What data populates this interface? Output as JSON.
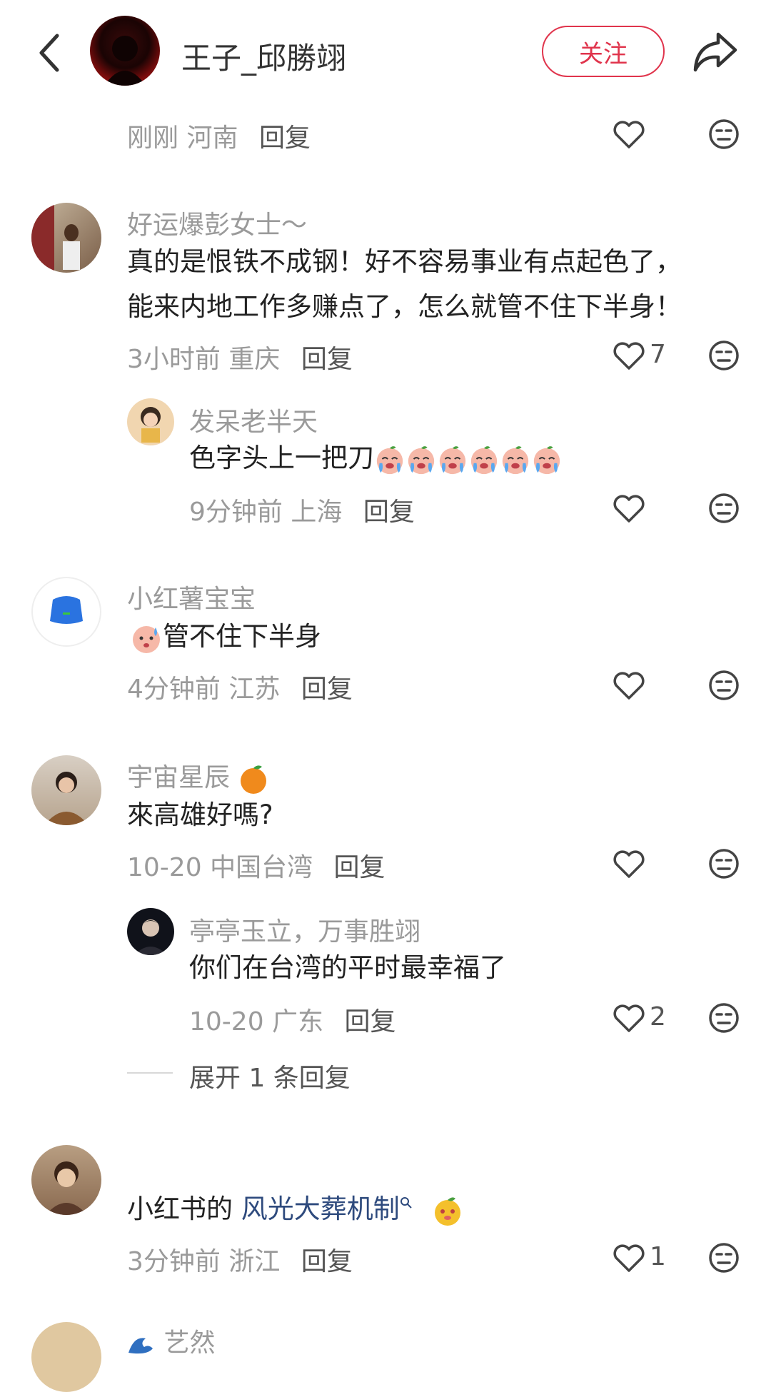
{
  "header": {
    "user_name": "王子_邱勝翊",
    "follow_label": "关注"
  },
  "top_comment": {
    "time": "刚刚",
    "location": "河南",
    "reply_label": "回复"
  },
  "comments": [
    {
      "user": "好运爆彭女士～",
      "lines": [
        "真的是恨铁不成钢！好不容易事业有点起色了，",
        "能来内地工作多赚点了，怎么就管不住下半身！"
      ],
      "time": "3小时前",
      "location": "重庆",
      "reply_label": "回复",
      "likes": "7"
    },
    {
      "user": "发呆老半天",
      "text": "色字头上一把刀",
      "time": "9分钟前",
      "location": "上海",
      "reply_label": "回复",
      "likes": ""
    },
    {
      "user": "小红薯宝宝",
      "text": "管不住下半身",
      "time": "4分钟前",
      "location": "江苏",
      "reply_label": "回复",
      "likes": ""
    },
    {
      "user": "宇宙星辰",
      "text": "來高雄好嗎?",
      "time": "10-20",
      "location": "中国台湾",
      "reply_label": "回复",
      "likes": ""
    },
    {
      "user": "亭亭玉立，万事胜翊",
      "text": "你们在台湾的平时最幸福了",
      "time": "10-20",
      "location": "广东",
      "reply_label": "回复",
      "likes": "2"
    },
    {
      "user": "",
      "text_prefix": "小红书的 ",
      "link": "风光大葬机制",
      "time": "3分钟前",
      "location": "浙江",
      "reply_label": "回复",
      "likes": "1"
    },
    {
      "user": "艺然"
    }
  ],
  "expand_replies_label": "展开 1 条回复",
  "colors": {
    "accent": "#e0344c",
    "muted": "#9a9a9a",
    "link": "#2e4a7d"
  },
  "icons": [
    "back-icon",
    "share-icon",
    "heart-icon",
    "dislike-face-icon",
    "search-icon"
  ]
}
